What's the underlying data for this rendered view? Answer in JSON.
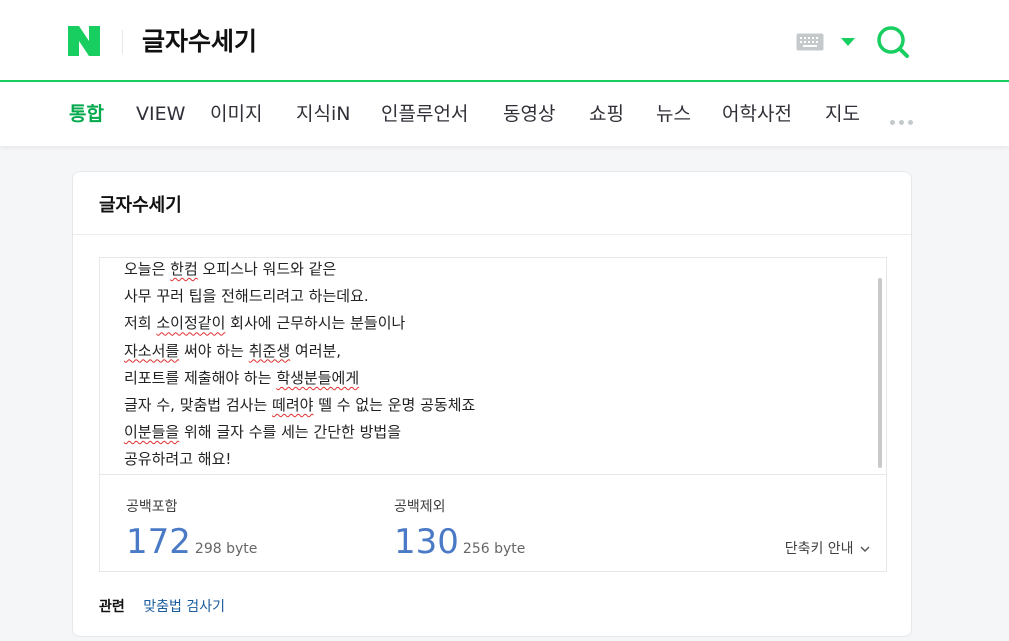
{
  "header": {
    "logo_letter": "N",
    "query": "글자수세기",
    "brand_color": "#19ce60"
  },
  "tabs": [
    {
      "label": "통합",
      "active": true
    },
    {
      "label": "VIEW"
    },
    {
      "label": "이미지"
    },
    {
      "label": "지식iN"
    },
    {
      "label": "인플루언서"
    },
    {
      "label": "동영상"
    },
    {
      "label": "쇼핑"
    },
    {
      "label": "뉴스"
    },
    {
      "label": "어학사전"
    },
    {
      "label": "지도"
    }
  ],
  "card": {
    "title": "글자수세기",
    "text_lines": [
      [
        "오늘은 ",
        {
          "s": "한컴"
        },
        " 오피스나 워드와 같은"
      ],
      [
        "사무 꾸러 팁을 전해드리려고 하는데요."
      ],
      [
        "저희 ",
        {
          "s": "소이정같이"
        },
        " 회사에 근무하시는 분들이나"
      ],
      [
        {
          "s": "자소서를"
        },
        " 써야 하는 ",
        {
          "s": "취준생"
        },
        " 여러분,"
      ],
      [
        "리포트를 제출해야 하는 ",
        {
          "s": "학생분들에게"
        }
      ],
      [
        "글자 수, 맞춤법 검사는 ",
        {
          "s": "떼려야"
        },
        " 뗄 수 없는 운명 공동체죠"
      ],
      [
        {
          "s": "이분들을"
        },
        " 위해 글자 수를 세는 간단한 방법을"
      ],
      [
        "공유하려고 해요!"
      ]
    ],
    "with_spaces": {
      "label": "공백포함",
      "count": "172",
      "bytes": "298 byte"
    },
    "without_spaces": {
      "label": "공백제외",
      "count": "130",
      "bytes": "256 byte"
    },
    "shortcut_label": "단축키 안내",
    "related_label": "관련",
    "related_link": "맞춤법 검사기"
  },
  "colors": {
    "accent_green": "#03a94d",
    "count_blue": "#4a7ac6",
    "link_blue": "#1a5b9c"
  }
}
